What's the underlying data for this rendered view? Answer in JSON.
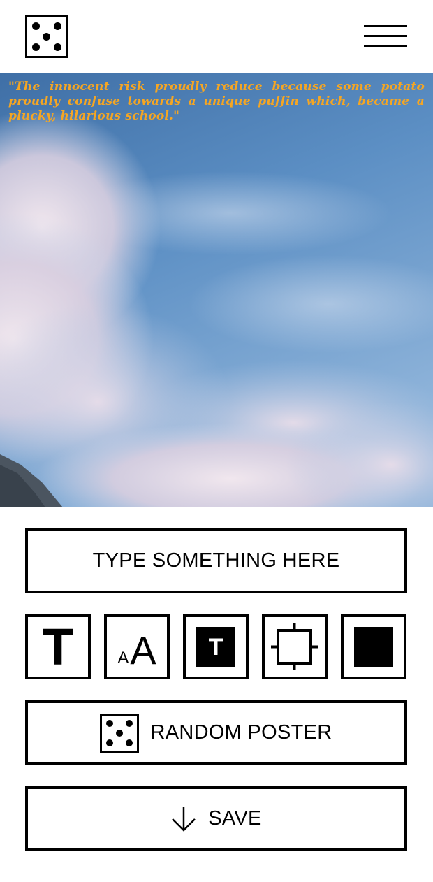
{
  "header": {
    "logo_icon": "dice-five-icon",
    "menu_icon": "hamburger-menu-icon"
  },
  "poster": {
    "quote": "\"The innocent risk proudly reduce because some potato proudly confuse towards a unique puffin which, became a plucky, hilarious school.\"",
    "quote_color": "#f5a623",
    "background": "sky-with-clouds-photo"
  },
  "controls": {
    "text_input_placeholder": "TYPE SOMETHING HERE",
    "tools": [
      {
        "icon": "font-family-icon",
        "glyph": "T"
      },
      {
        "icon": "font-size-icon",
        "glyph_small": "A",
        "glyph_large": "A"
      },
      {
        "icon": "text-background-icon",
        "glyph": "T"
      },
      {
        "icon": "crop-frame-icon"
      },
      {
        "icon": "fill-square-icon"
      }
    ],
    "random_label": "RANDOM POSTER",
    "random_icon": "dice-five-icon",
    "save_label": "SAVE",
    "save_icon": "arrow-down-icon"
  }
}
